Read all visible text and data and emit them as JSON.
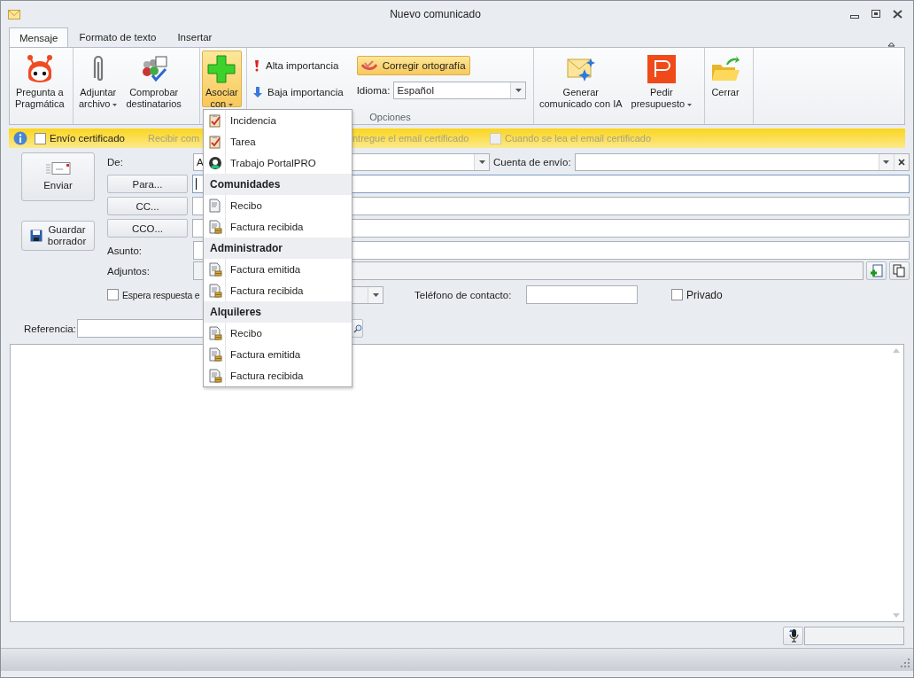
{
  "window": {
    "title": "Nuevo comunicado"
  },
  "tabs": [
    {
      "label": "Mensaje",
      "selected": true
    },
    {
      "label": "Formato de texto",
      "selected": false
    },
    {
      "label": "Insertar",
      "selected": false
    }
  ],
  "ribbon": {
    "pregunta": {
      "label": "Pregunta a\nPragmática",
      "dropdown": false
    },
    "adjuntar": {
      "label": "Adjuntar\narchivo",
      "dropdown": true
    },
    "comprobar": {
      "label": "Comprobar\ndestinatarios",
      "dropdown": false
    },
    "asociar": {
      "label": "Asociar\ncon",
      "dropdown": true,
      "pressed": true
    },
    "alta": {
      "label": "Alta importancia"
    },
    "baja": {
      "label": "Baja importancia"
    },
    "corregir": {
      "label": "Corregir ortografía",
      "pressed": true
    },
    "idioma": {
      "label": "Idioma:",
      "value": "Español"
    },
    "group_label": "Opciones",
    "generar": {
      "label": "Generar\ncomunicado con IA",
      "dropdown": false
    },
    "pedir": {
      "label": "Pedir\npresupuesto",
      "dropdown": true
    },
    "cerrar": {
      "label": "Cerrar",
      "dropdown": false
    }
  },
  "certificate": {
    "checkbox": {
      "label": "Envío certificado",
      "checked": false
    },
    "text_1": "Recibir com",
    "text_2": "ntregue el email certificado",
    "read_checkbox": {
      "label": "Cuando se lea el email certificado",
      "checked": false,
      "disabled": true
    }
  },
  "send_button": "Enviar",
  "save_button": "Guardar\nborrador",
  "from": {
    "label": "De:",
    "value": "A"
  },
  "account": {
    "label": "Cuenta de envío:"
  },
  "recipients": [
    {
      "button": "Para...",
      "focused": true
    },
    {
      "button": "CC...",
      "focused": false
    },
    {
      "button": "CCO...",
      "focused": false
    }
  ],
  "subject": {
    "label": "Asunto:"
  },
  "attachments": {
    "label": "Adjuntos:"
  },
  "reply": {
    "label": "Espera respuesta e",
    "checked": false
  },
  "phone": {
    "label": "Teléfono de contacto:"
  },
  "private": {
    "label": "Privado",
    "checked": false
  },
  "reference": {
    "label": "Referencia:"
  },
  "menu": {
    "items": [
      {
        "kind": "item",
        "label": "Incidencia"
      },
      {
        "kind": "item",
        "label": "Tarea"
      },
      {
        "kind": "item",
        "label": "Trabajo PortalPRO"
      },
      {
        "kind": "header",
        "label": "Comunidades"
      },
      {
        "kind": "item",
        "label": "Recibo"
      },
      {
        "kind": "item",
        "label": "Factura recibida"
      },
      {
        "kind": "header",
        "label": "Administrador"
      },
      {
        "kind": "item",
        "label": "Factura emitida"
      },
      {
        "kind": "item",
        "label": "Factura recibida"
      },
      {
        "kind": "header",
        "label": "Alquileres"
      },
      {
        "kind": "item",
        "label": "Recibo"
      },
      {
        "kind": "item",
        "label": "Factura emitida"
      },
      {
        "kind": "item",
        "label": "Factura recibida"
      }
    ]
  }
}
